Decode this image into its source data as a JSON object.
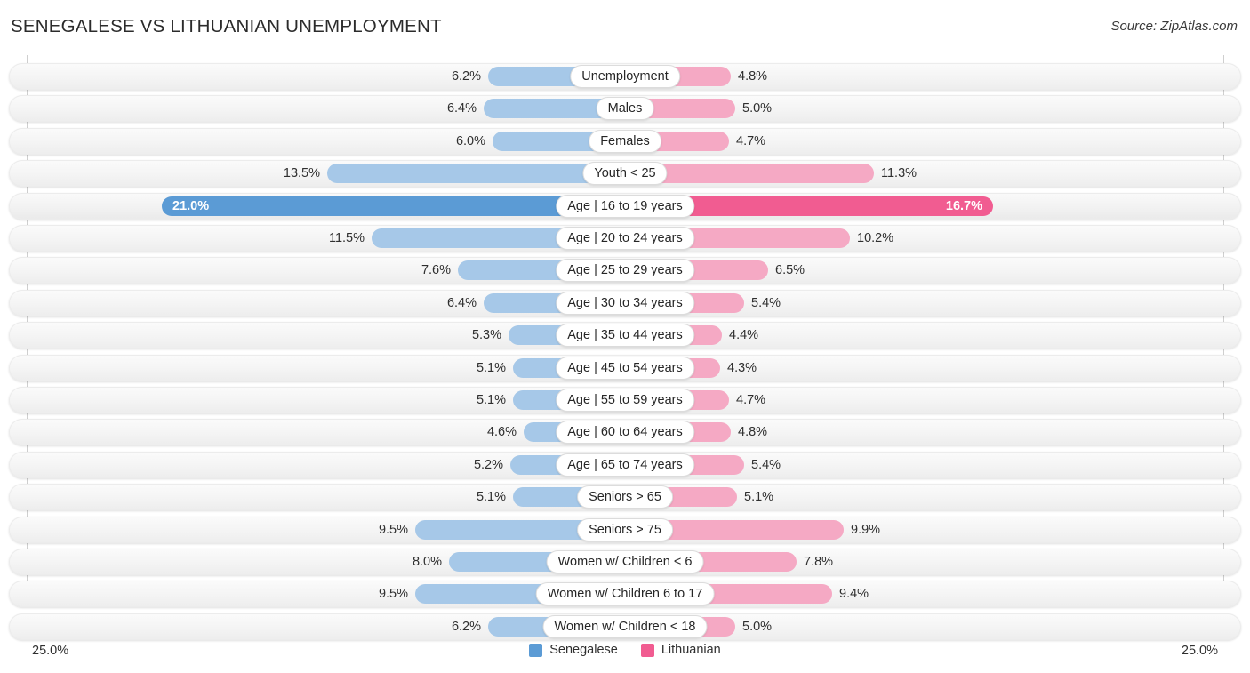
{
  "header": {
    "title": "SENEGALESE VS LITHUANIAN UNEMPLOYMENT",
    "source": "Source: ZipAtlas.com"
  },
  "axis": {
    "left_label": "25.0%",
    "right_label": "25.0%"
  },
  "legend": [
    {
      "label": "Senegalese",
      "color": "#5b9bd5"
    },
    {
      "label": "Lithuanian",
      "color": "#f15c91"
    }
  ],
  "colors": {
    "left_bar": "#a6c8e8",
    "right_bar": "#f5a9c4",
    "left_bar_highlight": "#5b9bd5",
    "right_bar_highlight": "#f15c91",
    "track": "#f4f4f4"
  },
  "chart_data": {
    "type": "bar",
    "title": "SENEGALESE VS LITHUANIAN UNEMPLOYMENT",
    "subtitle": "",
    "xlabel": "",
    "ylabel": "",
    "orientation": "horizontal-diverging",
    "axis_max_percent": 25.0,
    "xlim": [
      25.0,
      25.0
    ],
    "grid": false,
    "legend_position": "bottom-center",
    "categories": [
      "Unemployment",
      "Males",
      "Females",
      "Youth < 25",
      "Age | 16 to 19 years",
      "Age | 20 to 24 years",
      "Age | 25 to 29 years",
      "Age | 30 to 34 years",
      "Age | 35 to 44 years",
      "Age | 45 to 54 years",
      "Age | 55 to 59 years",
      "Age | 60 to 64 years",
      "Age | 65 to 74 years",
      "Seniors > 65",
      "Seniors > 75",
      "Women w/ Children < 6",
      "Women w/ Children 6 to 17",
      "Women w/ Children < 18"
    ],
    "series": [
      {
        "name": "Senegalese",
        "side": "left",
        "color": "#a6c8e8",
        "values": [
          6.2,
          6.4,
          6.0,
          13.5,
          21.0,
          11.5,
          7.6,
          6.4,
          5.3,
          5.1,
          5.1,
          4.6,
          5.2,
          5.1,
          9.5,
          8.0,
          9.5,
          6.2
        ],
        "labels": [
          "6.2%",
          "6.4%",
          "6.0%",
          "13.5%",
          "21.0%",
          "11.5%",
          "7.6%",
          "6.4%",
          "5.3%",
          "5.1%",
          "5.1%",
          "4.6%",
          "5.2%",
          "5.1%",
          "9.5%",
          "8.0%",
          "9.5%",
          "6.2%"
        ]
      },
      {
        "name": "Lithuanian",
        "side": "right",
        "color": "#f5a9c4",
        "values": [
          4.8,
          5.0,
          4.7,
          11.3,
          16.7,
          10.2,
          6.5,
          5.4,
          4.4,
          4.3,
          4.7,
          4.8,
          5.4,
          5.1,
          9.9,
          7.8,
          9.4,
          5.0
        ],
        "labels": [
          "4.8%",
          "5.0%",
          "4.7%",
          "11.3%",
          "16.7%",
          "10.2%",
          "6.5%",
          "5.4%",
          "4.4%",
          "4.3%",
          "4.7%",
          "4.8%",
          "5.4%",
          "5.1%",
          "9.9%",
          "7.8%",
          "9.4%",
          "5.0%"
        ]
      }
    ],
    "highlighted_row_index": 4
  }
}
